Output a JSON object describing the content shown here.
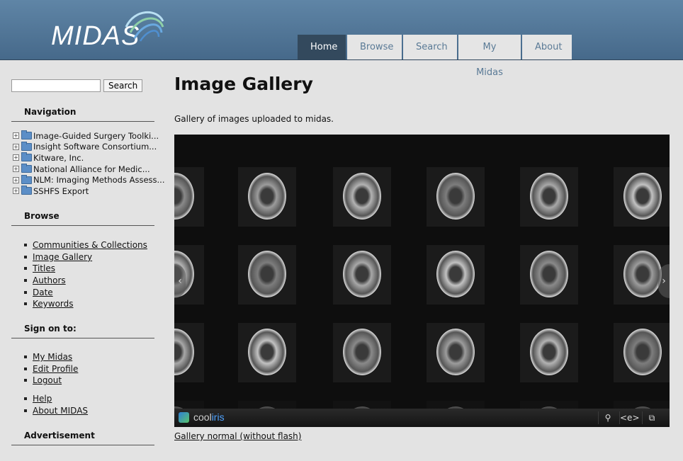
{
  "header": {
    "logo_text": "MIDAS",
    "tabs": [
      "Home",
      "Browse",
      "Search",
      "My Midas",
      "About"
    ],
    "active_tab": "Home"
  },
  "sidebar": {
    "search_button": "Search",
    "search_value": "",
    "navigation_heading": "Navigation",
    "tree_items": [
      "Image-Guided Surgery Toolki...",
      "Insight Software Consortium...",
      "Kitware, Inc.",
      "National Alliance for Medic...",
      "NLM: Imaging Methods Assess...",
      "SSHFS Export"
    ],
    "browse_heading": "Browse",
    "browse_links": [
      "Communities & Collections",
      "Image Gallery",
      "Titles",
      "Authors",
      "Date",
      "Keywords"
    ],
    "signon_heading": "Sign on to:",
    "account_links": [
      "My Midas",
      "Edit Profile",
      "Logout"
    ],
    "help_links": [
      "Help",
      "About MIDAS"
    ],
    "advertisement_heading": "Advertisement"
  },
  "main": {
    "title": "Image Gallery",
    "description": "Gallery of images uploaded to midas.",
    "gallery_brand_prefix": "cool",
    "gallery_brand_suffix": "iris",
    "gallery_link": "Gallery normal (without flash)"
  },
  "colors": {
    "header_top": "#5f85a6",
    "active_tab": "#33495d",
    "inactive_tab_text": "#5a7a96"
  }
}
